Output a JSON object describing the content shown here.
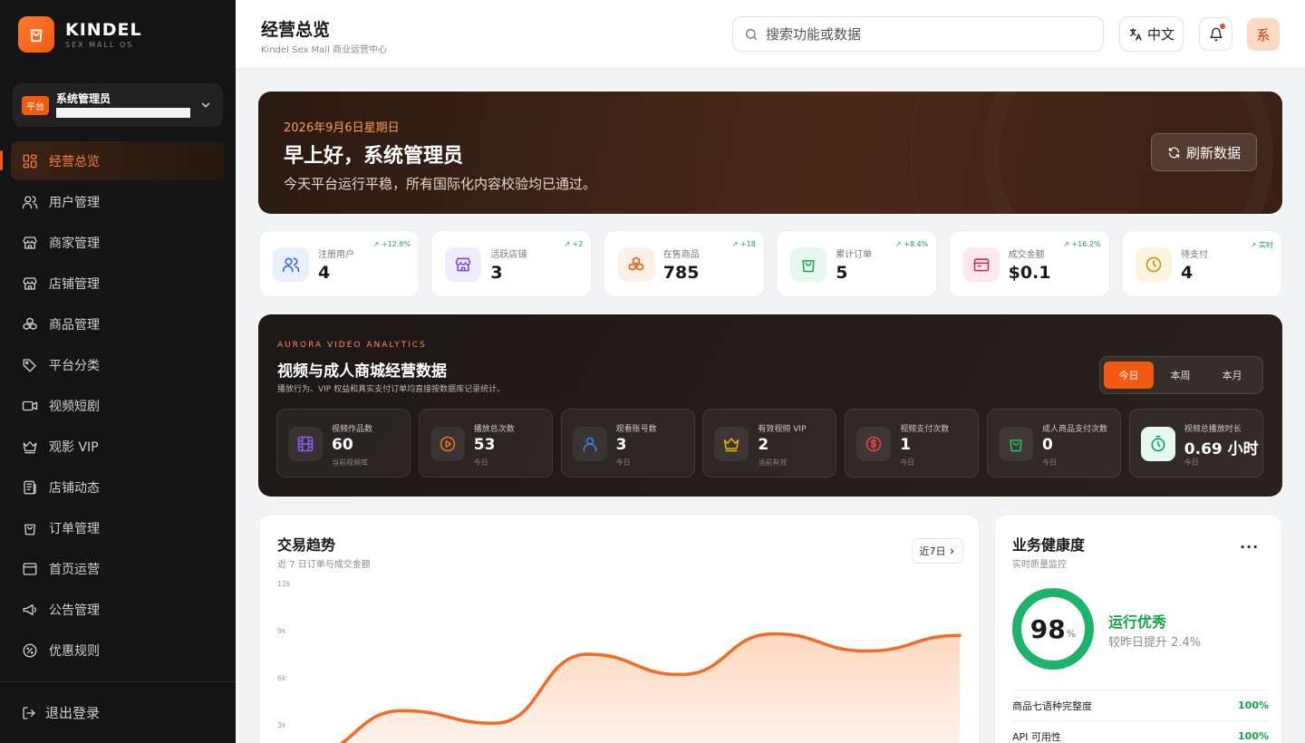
{
  "brand": {
    "name": "KINDEL",
    "sub": "SEX MALL OS"
  },
  "account": {
    "badge": "平台",
    "name": "系统管理员"
  },
  "nav": [
    {
      "label": "经营总览",
      "icon": "dashboard-icon",
      "active": true
    },
    {
      "label": "用户管理",
      "icon": "users-icon"
    },
    {
      "label": "商家管理",
      "icon": "store-icon"
    },
    {
      "label": "店铺管理",
      "icon": "store-icon"
    },
    {
      "label": "商品管理",
      "icon": "boxes-icon"
    },
    {
      "label": "平台分类",
      "icon": "tags-icon"
    },
    {
      "label": "视频短剧",
      "icon": "video-icon"
    },
    {
      "label": "观影 VIP",
      "icon": "crown-icon"
    },
    {
      "label": "店铺动态",
      "icon": "newspaper-icon"
    },
    {
      "label": "订单管理",
      "icon": "shopping-bag-icon"
    },
    {
      "label": "首页运营",
      "icon": "layout-icon"
    },
    {
      "label": "公告管理",
      "icon": "megaphone-icon"
    },
    {
      "label": "优惠规则",
      "icon": "percent-icon"
    }
  ],
  "logout": "退出登录",
  "header": {
    "title": "经营总览",
    "subtitle": "Kindel Sex Mall 商业运营中心",
    "search_placeholder": "搜索功能或数据",
    "lang": "中文",
    "avatar": "系"
  },
  "hero": {
    "date": "2026年9月6日星期日",
    "greeting": "早上好，系统管理员",
    "desc": "今天平台运行平稳，所有国际化内容校验均已通过。",
    "refresh": "刷新数据"
  },
  "stats": [
    {
      "label": "注册用户",
      "value": "4",
      "trend": "↗ +12.8%",
      "icon": "users-icon",
      "color": "#2563eb",
      "bg": "#eaf1fe"
    },
    {
      "label": "活跃店铺",
      "value": "3",
      "trend": "↗ +2",
      "icon": "store-icon",
      "color": "#7c3aed",
      "bg": "#f1ebfe"
    },
    {
      "label": "在售商品",
      "value": "785",
      "trend": "↗ +18",
      "icon": "boxes-icon",
      "color": "#ea580c",
      "bg": "#fef0e6"
    },
    {
      "label": "累计订单",
      "value": "5",
      "trend": "↗ +8.4%",
      "icon": "shopping-bag-icon",
      "color": "#16a34a",
      "bg": "#e7f8ee"
    },
    {
      "label": "成交金额",
      "value": "$0.1",
      "trend": "↗ +16.2%",
      "icon": "wallet-icon",
      "color": "#e11d48",
      "bg": "#fde8ee"
    },
    {
      "label": "待支付",
      "value": "4",
      "trend": "↗ 实时",
      "icon": "clock-icon",
      "color": "#ca8a04",
      "bg": "#fdf5de"
    }
  ],
  "video": {
    "eyebrow": "AURORA VIDEO ANALYTICS",
    "title": "视频与成人商城经营数据",
    "desc": "播放行为、VIP 权益和真实支付订单均直接按数据库记录统计。",
    "tabs": [
      "今日",
      "本周",
      "本月"
    ],
    "active_tab": 0,
    "cards": [
      {
        "label": "视频作品数",
        "value": "60",
        "sub": "当前视频库",
        "icon": "film-icon",
        "color": "#8b5cf6"
      },
      {
        "label": "播放总次数",
        "value": "53",
        "sub": "今日",
        "icon": "play-icon",
        "color": "#f97316"
      },
      {
        "label": "观看账号数",
        "value": "3",
        "sub": "今日",
        "icon": "user-icon",
        "color": "#3b82f6"
      },
      {
        "label": "有效视频 VIP",
        "value": "2",
        "sub": "当前有效",
        "icon": "crown-icon",
        "color": "#eab308"
      },
      {
        "label": "视频支付次数",
        "value": "1",
        "sub": "今日",
        "icon": "dollar-icon",
        "color": "#ef4444"
      },
      {
        "label": "成人商品支付次数",
        "value": "0",
        "sub": "今日",
        "icon": "shopping-bag-icon",
        "color": "#22c55e"
      },
      {
        "label": "视频总播放时长",
        "value": "0.69 小时",
        "sub": "今日",
        "icon": "timer-icon",
        "color": "#059669"
      }
    ]
  },
  "trend": {
    "title": "交易趋势",
    "subtitle": "近 7 日订单与成交金额",
    "range": "近7日",
    "chart_data": {
      "type": "area",
      "y_ticks": [
        "12k",
        "9k",
        "6k",
        "3k"
      ],
      "ylim": [
        0,
        12000
      ],
      "values": [
        1200,
        3900,
        3100,
        7500,
        6200,
        8800,
        7700,
        8700
      ],
      "color": "#f26a23"
    }
  },
  "health": {
    "title": "业务健康度",
    "subtitle": "实时质量监控",
    "score": "98",
    "score_value": 0.98,
    "unit": "%",
    "status": "运行优秀",
    "delta": "较昨日提升 2.4%",
    "rows": [
      {
        "label": "商品七语种完整度",
        "value": "100%"
      },
      {
        "label": "API 可用性",
        "value": "100%"
      }
    ]
  }
}
